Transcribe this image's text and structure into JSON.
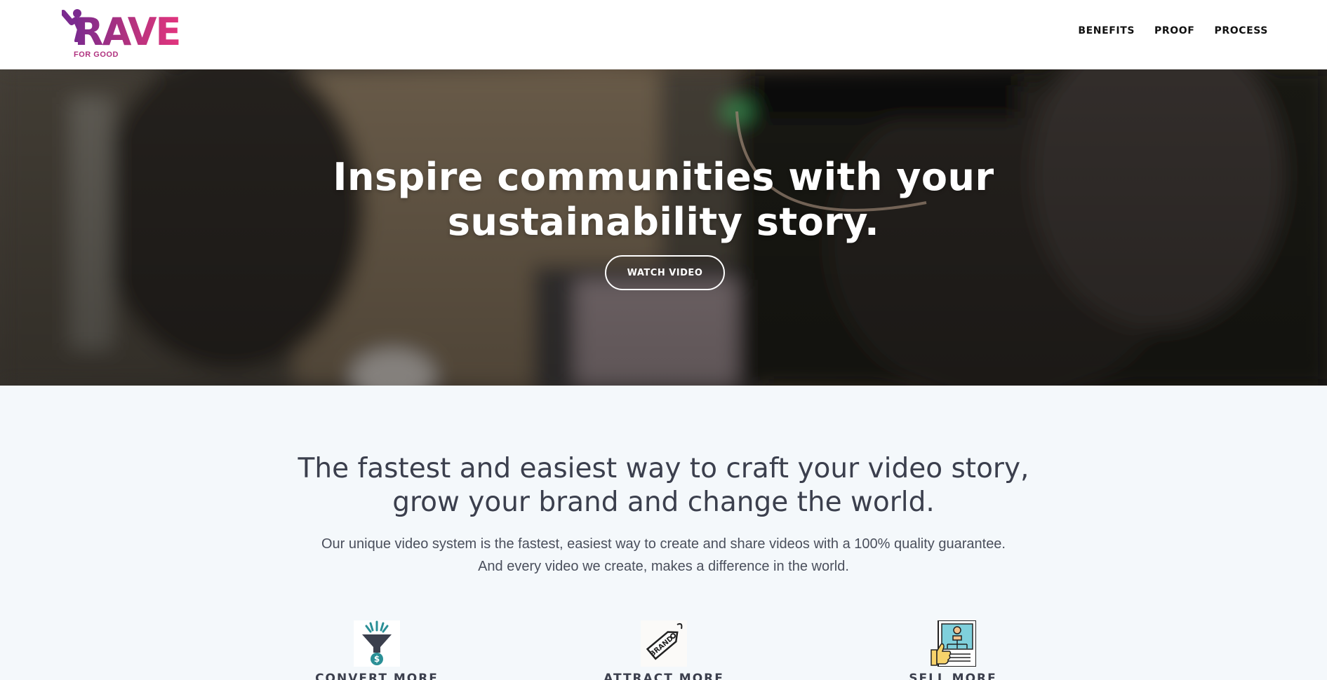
{
  "header": {
    "logo_word": "RAVE",
    "logo_sub": "FOR GOOD",
    "nav": [
      {
        "label": "BENEFITS"
      },
      {
        "label": "PROOF"
      },
      {
        "label": "PROCESS"
      }
    ]
  },
  "hero": {
    "title_line1": "Inspire communities with your",
    "title_line2": "sustainability story.",
    "button_label": "WATCH VIDEO"
  },
  "intro": {
    "title_line1": "The fastest and easiest way to craft your video story,",
    "title_line2": "grow your brand and change the world.",
    "text_line1": "Our unique video system is the fastest, easiest way to create and share videos with a 100% quality guarantee.",
    "text_line2": "And every video we create, makes a difference in the world."
  },
  "features": [
    {
      "label": "CONVERT MORE",
      "icon": "funnel-dollar-icon"
    },
    {
      "label": "ATTRACT MORE",
      "icon": "brand-tag-icon"
    },
    {
      "label": "SELL MORE",
      "icon": "thumbs-up-review-icon"
    }
  ],
  "colors": {
    "brand_purple": "#7b2a8f",
    "brand_pink": "#e2357e",
    "text_dark": "#3b3f4d",
    "section_bg": "#f4f8fb"
  }
}
